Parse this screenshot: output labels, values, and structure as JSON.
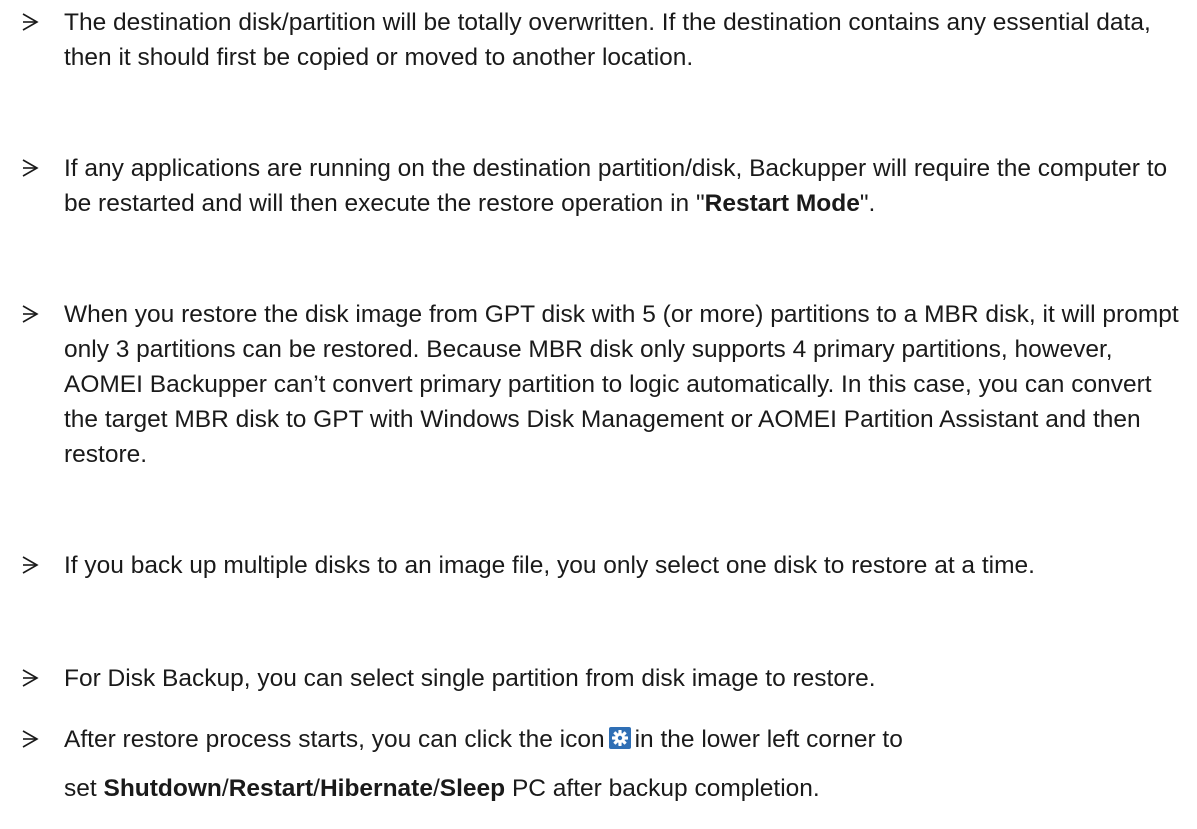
{
  "notes": [
    {
      "text": "The destination disk/partition will be totally overwritten. If the destination contains any essential data, then it should first be copied or moved to another location."
    },
    {
      "text_before": "If any applications are running on the destination partition/disk, Backupper will require the computer to be restarted and will then execute the restore operation in \"",
      "bold": "Restart Mode",
      "text_after": "\"."
    },
    {
      "text": "When you restore the disk image from GPT disk with 5 (or more) partitions to a MBR disk, it will prompt only 3 partitions can be restored. Because MBR disk only supports 4 primary partitions, however, AOMEI Backupper can’t convert primary partition to logic automatically. In this case, you can convert the target MBR disk to GPT with Windows Disk Management or AOMEI Partition Assistant and then restore."
    },
    {
      "text": "If you back up multiple disks to an image file, you only select one disk to restore at a time."
    },
    {
      "text": "For Disk Backup, you can select single partition from disk image to restore."
    },
    {
      "line1_before": "After restore process starts, you can click the icon",
      "line1_after": "in the lower left corner to",
      "line2_before": "set",
      "opt1": "Shutdown",
      "sep1": "/",
      "opt2": "Restart",
      "sep2": "/",
      "opt3": "Hibernate",
      "sep3": "/",
      "opt4": "Sleep",
      "line2_after": "PC after backup completion.",
      "icon": "gear-icon"
    }
  ],
  "colors": {
    "text": "#1a1a1a",
    "icon_bg": "#2f6fb5"
  }
}
